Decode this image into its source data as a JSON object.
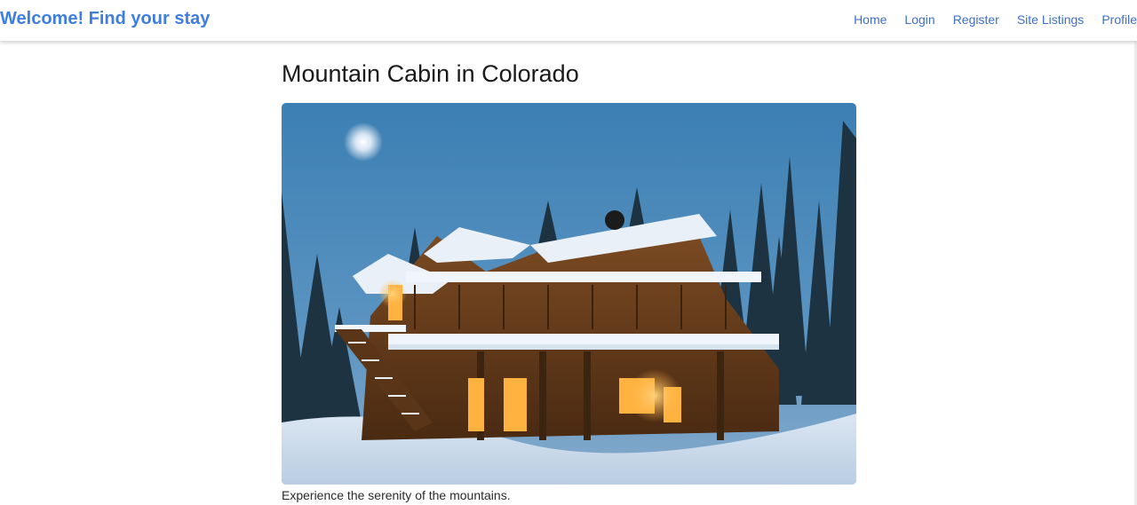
{
  "navbar": {
    "brand": "Welcome! Find your stay",
    "links": [
      "Home",
      "Login",
      "Register",
      "Site Listings",
      "Profile"
    ]
  },
  "listing": {
    "title": "Mountain Cabin in Colorado",
    "image_alt": "Log cabin in the snow at dusk",
    "caption": "Experience the serenity of the mountains."
  },
  "colors": {
    "brand": "#3d7ee0",
    "link": "#3f6fc4"
  }
}
